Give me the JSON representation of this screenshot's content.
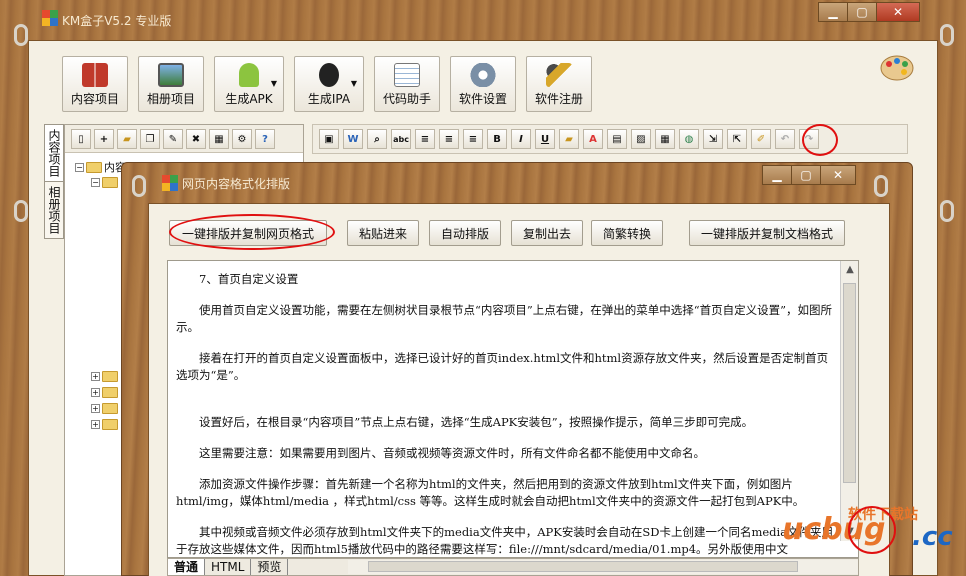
{
  "app": {
    "title": "KM盒子V5.2 专业版"
  },
  "toolbar": {
    "buttons": [
      {
        "label": "内容项目",
        "icon": "book-icon"
      },
      {
        "label": "相册项目",
        "icon": "photo-icon"
      },
      {
        "label": "生成APK",
        "icon": "android-icon"
      },
      {
        "label": "生成IPA",
        "icon": "apple-icon"
      },
      {
        "label": "代码助手",
        "icon": "notepad-icon"
      },
      {
        "label": "软件设置",
        "icon": "gear-icon"
      },
      {
        "label": "软件注册",
        "icon": "keys-icon"
      }
    ]
  },
  "side_tabs": [
    "内容项目",
    "相册项目"
  ],
  "tree": {
    "root_label": "内容项目"
  },
  "dialog": {
    "title": "网页内容格式化排版",
    "actions": {
      "format_copy_web": "一键排版并复制网页格式",
      "paste_in": "粘贴进来",
      "auto_format": "自动排版",
      "copy_out": "复制出去",
      "convert": "简繁转换",
      "format_copy_doc": "一键排版并复制文档格式"
    },
    "paragraphs": [
      "7、首页自定义设置",
      "使用首页自定义设置功能，需要在左侧树状目录根节点“内容项目”上点右键，在弹出的菜单中选择“首页自定义设置”，如图所示。",
      "接着在打开的首页自定义设置面板中，选择已设计好的首页index.html文件和html资源存放文件夹，然后设置是否定制首页选项为“是”。",
      "设置好后，在根目录“内容项目”节点上点右键，选择“生成APK安装包”，按照操作提示，简单三步即可完成。",
      "这里需要注意：如果需要用到图片、音频或视频等资源文件时，所有文件命名都不能使用中文命名。",
      "添加资源文件操作步骤：首先新建一个名称为html的文件夹，然后把用到的资源文件放到html文件夹下面，例如图片html/img，媒体html/media ，样式html/css 等等。这样生成时就会自动把html文件夹中的资源文件一起打包到APK中。",
      "其中视频或音频文件必须存放到html文件夹下的media文件夹中，APK安装时会自动在SD卡上创建一个同名media文件夹用于存放这些媒体文件，因而html5播放代码中的路径需要这样写：file:///mnt/sdcard/media/01.mp4。另外版使用中文"
    ],
    "bottom_tabs": [
      "普通",
      "HTML",
      "预览"
    ]
  },
  "watermark": {
    "top": "软件下载站",
    "logo": "ucbug",
    "suffix": ".cc"
  },
  "colors": {
    "highlight_ring": "#e01010",
    "wood": "#a8743f",
    "paper": "#f4f0e4"
  }
}
